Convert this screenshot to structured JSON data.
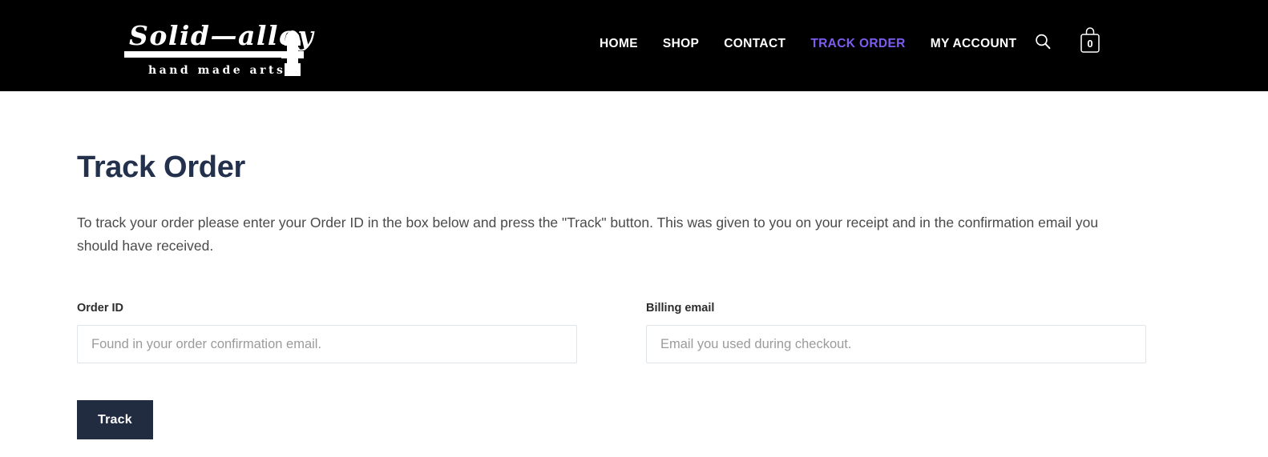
{
  "header": {
    "logo": {
      "name": "solid-alloy-logo",
      "brand_line1": "Solid—alloy",
      "brand_line2": "hand made arts",
      "mark": "hammer-mark"
    },
    "nav": [
      {
        "label": "HOME",
        "name": "nav-item-home",
        "active": false
      },
      {
        "label": "SHOP",
        "name": "nav-item-shop",
        "active": false
      },
      {
        "label": "CONTACT",
        "name": "nav-item-contact",
        "active": false
      },
      {
        "label": "TRACK ORDER",
        "name": "nav-item-track-order",
        "active": true
      },
      {
        "label": "MY ACCOUNT",
        "name": "nav-item-my-account",
        "active": false
      }
    ],
    "search_icon": "search-icon",
    "cart": {
      "icon": "shopping-bag-icon",
      "count": "0"
    },
    "colors": {
      "background": "#000000",
      "nav_text": "#ffffff",
      "nav_active": "#7d5cf0"
    }
  },
  "main": {
    "title": "Track Order",
    "intro": "To track your order please enter your Order ID in the box below and press the \"Track\" button. This was given to you on your receipt and in the confirmation email you should have received.",
    "form": {
      "order_id": {
        "label": "Order ID",
        "placeholder": "Found in your order confirmation email.",
        "value": ""
      },
      "billing_email": {
        "label": "Billing email",
        "placeholder": "Email you used during checkout.",
        "value": ""
      },
      "submit_label": "Track"
    },
    "colors": {
      "page_background": "#ffffff",
      "title": "#24314c",
      "body_text": "#4a4a4a",
      "input_border": "#e0e5ea",
      "placeholder": "#9b9b9b",
      "button_background": "#212c40",
      "button_text": "#ffffff"
    }
  }
}
